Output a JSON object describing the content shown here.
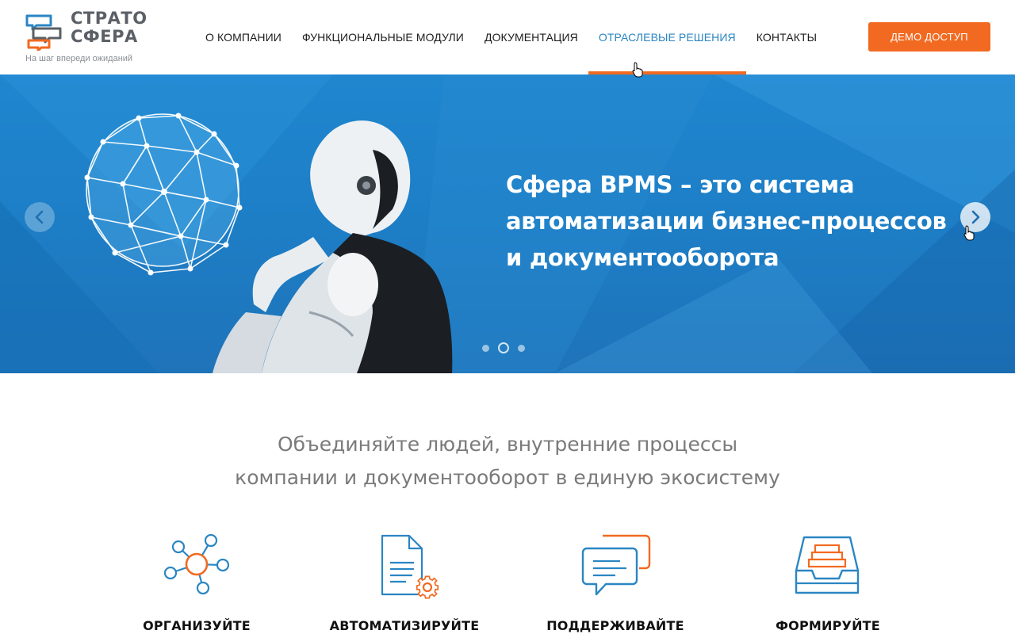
{
  "brand": {
    "line1": "СТРАТО",
    "line2": "СФЕРА",
    "tagline": "На шаг впереди ожиданий"
  },
  "nav": {
    "items": [
      {
        "label": "О КОМПАНИИ"
      },
      {
        "label": "ФУНКЦИОНАЛЬНЫЕ МОДУЛИ"
      },
      {
        "label": "ДОКУМЕНТАЦИЯ"
      },
      {
        "label": "ОТРАСЛЕВЫЕ РЕШЕНИЯ"
      },
      {
        "label": "КОНТАКТЫ"
      }
    ],
    "active_index": 3
  },
  "demo_button": {
    "label": "ДЕМО ДОСТУП"
  },
  "hero": {
    "title": "Сфера BPMS – это система автоматизации бизнес-процессов и документооборота",
    "slides_count": 3,
    "active_slide": 2
  },
  "intro": {
    "line1": "Объединяйте людей, внутренние процессы",
    "line2": "компании и документооборот в единую экосистему"
  },
  "features": [
    {
      "label": "ОРГАНИЗУЙТЕ",
      "icon": "network-icon"
    },
    {
      "label": "АВТОМАТИЗИРУЙТЕ",
      "icon": "document-gear-icon"
    },
    {
      "label": "ПОДДЕРЖИВАЙТЕ",
      "icon": "chat-icon"
    },
    {
      "label": "ФОРМИРУЙТЕ",
      "icon": "archive-tray-icon"
    }
  ],
  "colors": {
    "accent": "#f26a21",
    "link_active": "#2a86c3",
    "hero_blue": "#1f80c9",
    "icon_blue": "#2a86c3",
    "icon_orange": "#f26a21"
  }
}
